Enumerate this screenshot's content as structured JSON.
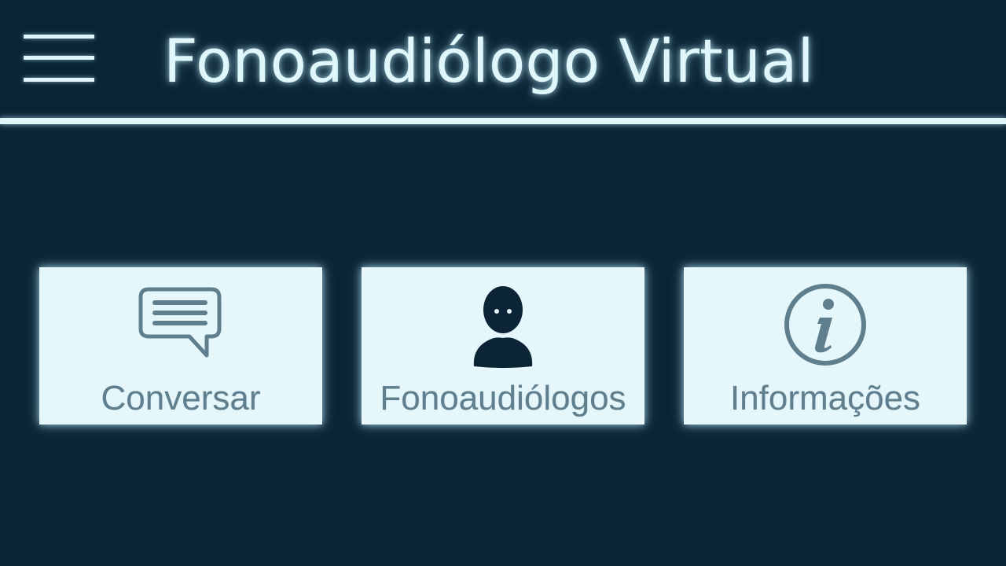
{
  "header": {
    "menu_icon": "hamburger-menu-icon",
    "title": "Fonoaudiólogo Virtual"
  },
  "tiles": [
    {
      "label": "Conversar",
      "icon": "chat-bubble-icon"
    },
    {
      "label": "Fonoaudiólogos",
      "icon": "person-icon"
    },
    {
      "label": "Informações",
      "icon": "info-icon"
    }
  ],
  "colors": {
    "background": "#0b2536",
    "accent": "#dff6fb",
    "tile_background": "#e6f7fb",
    "tile_icon": "#5f7f8e",
    "person_icon": "#0b2536"
  }
}
